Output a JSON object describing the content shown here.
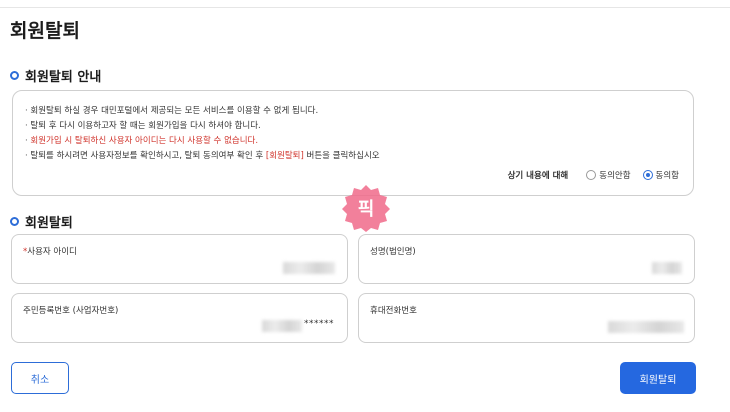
{
  "page": {
    "title": "회원탈퇴"
  },
  "notice_section": {
    "heading": "회원탈퇴 안내",
    "lines": [
      "회원탈퇴 하실 경우 대민포털에서 제공되는 모든 서비스를 이용할 수 없게 됩니다.",
      "탈퇴 후  다시 이용하고자 할 때는 회원가입을 다시 하셔야 합니다.",
      "회원가입 시 탈퇴하신 사용자 아이디는 다시 사용할 수 없습니다.",
      "탈퇴를 하시려면 사용자정보를 확인하시고, 탈퇴 동의여부 확인 후 ",
      "[회원탈퇴]",
      " 버튼을 클릭하십시오"
    ],
    "agree_question": "상기 내용에 대해",
    "options": [
      "동의안함",
      "동의함"
    ],
    "selected_option": "동의함"
  },
  "form_section": {
    "heading": "회원탈퇴",
    "required_mark": "*",
    "fields": {
      "user_id": {
        "label": "사용자 아이디"
      },
      "name": {
        "label": "성명(법인명)"
      },
      "reg_number": {
        "label": "주민등록번호 (사업자번호)",
        "masked_suffix": "******"
      },
      "mobile": {
        "label": "휴대전화번호"
      }
    }
  },
  "buttons": {
    "cancel": "취소",
    "submit": "회원탈퇴"
  },
  "watermark": {
    "text": "픽",
    "color": "#f06a8a"
  },
  "colors": {
    "accent": "#2d6dd8",
    "warning": "#d0342c"
  }
}
